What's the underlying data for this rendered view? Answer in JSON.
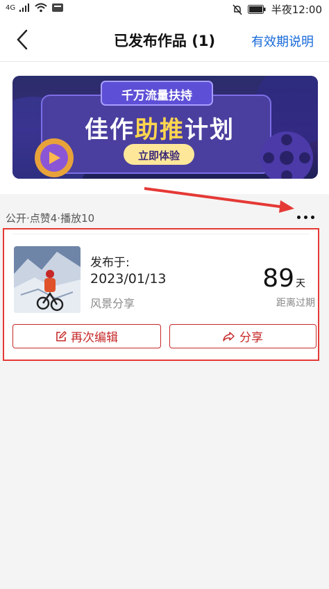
{
  "status_bar": {
    "network": "4G",
    "time": "半夜12:00"
  },
  "header": {
    "title": "已发布作品 (1)",
    "validity_link": "有效期说明"
  },
  "banner": {
    "top_tag": "千万流量扶持",
    "headline_a": "佳作",
    "headline_b": "助推",
    "headline_c": "计划",
    "cta": "立即体验"
  },
  "list": {
    "stats": "公开·点赞4·播放10"
  },
  "work_card": {
    "published_label": "发布于:",
    "published_date": "2023/01/13",
    "category": "风景分享",
    "days_left": "89",
    "days_unit": "天",
    "days_caption": "距离过期",
    "edit_label": "再次编辑",
    "share_label": "分享"
  },
  "colors": {
    "accent_blue": "#1769d9",
    "accent_red": "#c62828",
    "annotation_red": "#e53935"
  }
}
